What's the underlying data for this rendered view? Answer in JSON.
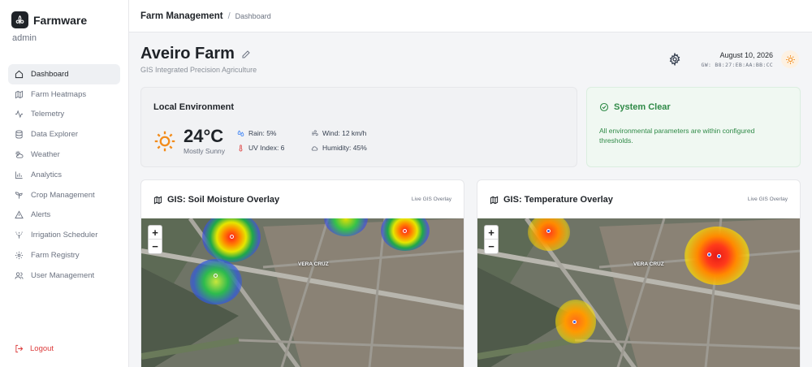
{
  "brand": {
    "name": "Farmware"
  },
  "user": {
    "role": "admin"
  },
  "nav": [
    {
      "label": "Dashboard",
      "icon": "home-icon",
      "active": true
    },
    {
      "label": "Farm Heatmaps",
      "icon": "map-icon"
    },
    {
      "label": "Telemetry",
      "icon": "activity-icon"
    },
    {
      "label": "Data Explorer",
      "icon": "database-icon"
    },
    {
      "label": "Weather",
      "icon": "weather-icon"
    },
    {
      "label": "Analytics",
      "icon": "bar-chart-icon"
    },
    {
      "label": "Crop Management",
      "icon": "sprout-icon"
    },
    {
      "label": "Alerts",
      "icon": "alert-triangle-icon"
    },
    {
      "label": "Irrigation Scheduler",
      "icon": "sprinkler-icon"
    },
    {
      "label": "Farm Registry",
      "icon": "settings-icon"
    },
    {
      "label": "User Management",
      "icon": "users-icon"
    }
  ],
  "logout": {
    "label": "Logout"
  },
  "breadcrumb": {
    "main": "Farm Management",
    "sep": "/",
    "sub": "Dashboard"
  },
  "farm": {
    "name": "Aveiro Farm",
    "subtitle": "GIS Integrated Precision Agriculture"
  },
  "header": {
    "date": "August 10, 2026",
    "gateway": "GW: B8:27:EB:AA:BB:CC"
  },
  "environment": {
    "title": "Local Environment",
    "temperature": "24°C",
    "condition": "Mostly Sunny",
    "rain": "Rain: 5%",
    "uv": "UV Index: 6",
    "wind": "Wind: 12 km/h",
    "humidity": "Humidity: 45%"
  },
  "system": {
    "title": "System Clear",
    "message": "All environmental parameters are within configured thresholds."
  },
  "maps": [
    {
      "title": "GIS: Soil Moisture Overlay",
      "tag": "Live GIS Overlay",
      "place_label": "VERA CRUZ"
    },
    {
      "title": "GIS: Temperature Overlay",
      "tag": "Live GIS Overlay",
      "place_label": "VERA CRUZ"
    }
  ],
  "zoom": {
    "plus": "+",
    "minus": "−"
  },
  "colors": {
    "accent": "#2f8a47",
    "danger": "#dc3b3b",
    "sun": "#f28c1b"
  }
}
